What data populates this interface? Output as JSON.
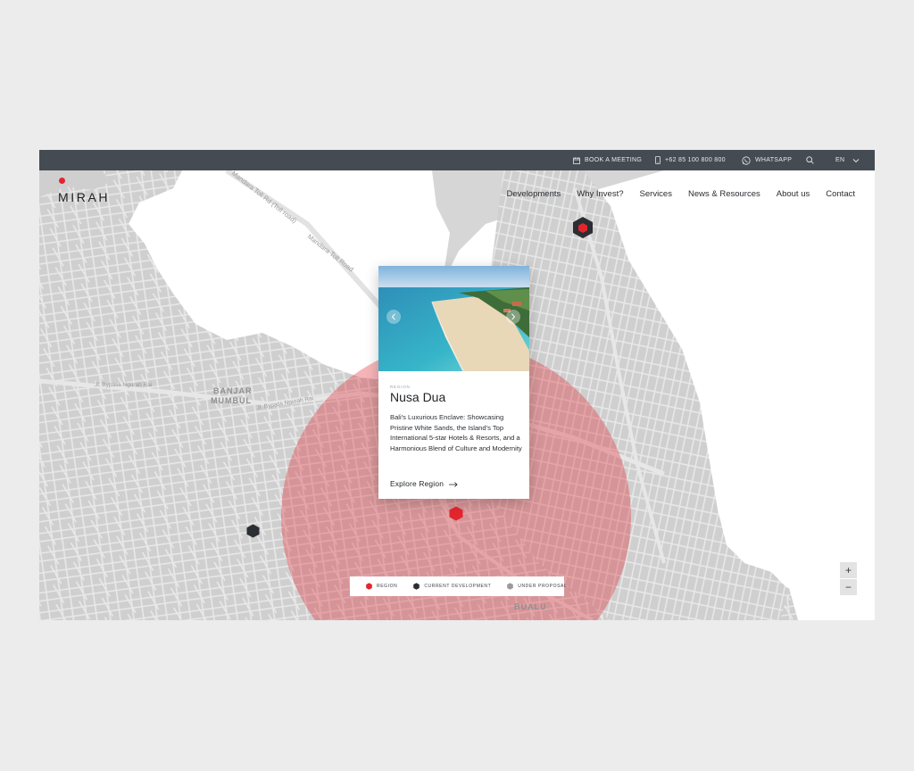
{
  "topbar": {
    "book_meeting": "BOOK A MEETING",
    "phone": "+62 85 100 800 800",
    "whatsapp": "WHATSAPP",
    "language": "EN"
  },
  "brand": {
    "name": "MIRAH",
    "accent_color": "#e3262e"
  },
  "nav": {
    "items": [
      "Developments",
      "Why Invest?",
      "Services",
      "News & Resources",
      "About us",
      "Contact"
    ]
  },
  "map": {
    "labels": {
      "banjar": "BANJAR",
      "mumbul": "MUMBUL",
      "bualu": "BUALU",
      "toll_road_1": "Mandara Toll Rd (Toll road)",
      "toll_road_2": "Mandara Toll Road",
      "bypass_1": "Jl. Bypass Ngurah Rai",
      "bypass_2": "Jl. Bypass Ngurah Rai"
    },
    "region_color": "#e3262e",
    "current_dev_color": "#2b2e33",
    "proposal_color": "#9a9a9a"
  },
  "card": {
    "eyebrow": "REGION",
    "title": "Nusa Dua",
    "description": "Bali's Luxurious Enclave: Showcasing Pristine White Sands, the Island's Top International 5-star Hotels & Resorts, and a Harmonious Blend of Culture and Modernity",
    "cta": "Explore Region",
    "prev_icon": "chevron-left-icon",
    "next_icon": "chevron-right-icon"
  },
  "legend": {
    "items": [
      {
        "label": "REGION",
        "color": "#e3262e"
      },
      {
        "label": "CURRENT DEVELOPMENT",
        "color": "#2b2e33"
      },
      {
        "label": "UNDER PROPOSAL",
        "color": "#9a9a9a"
      }
    ]
  },
  "zoom": {
    "in": "+",
    "out": "−"
  }
}
